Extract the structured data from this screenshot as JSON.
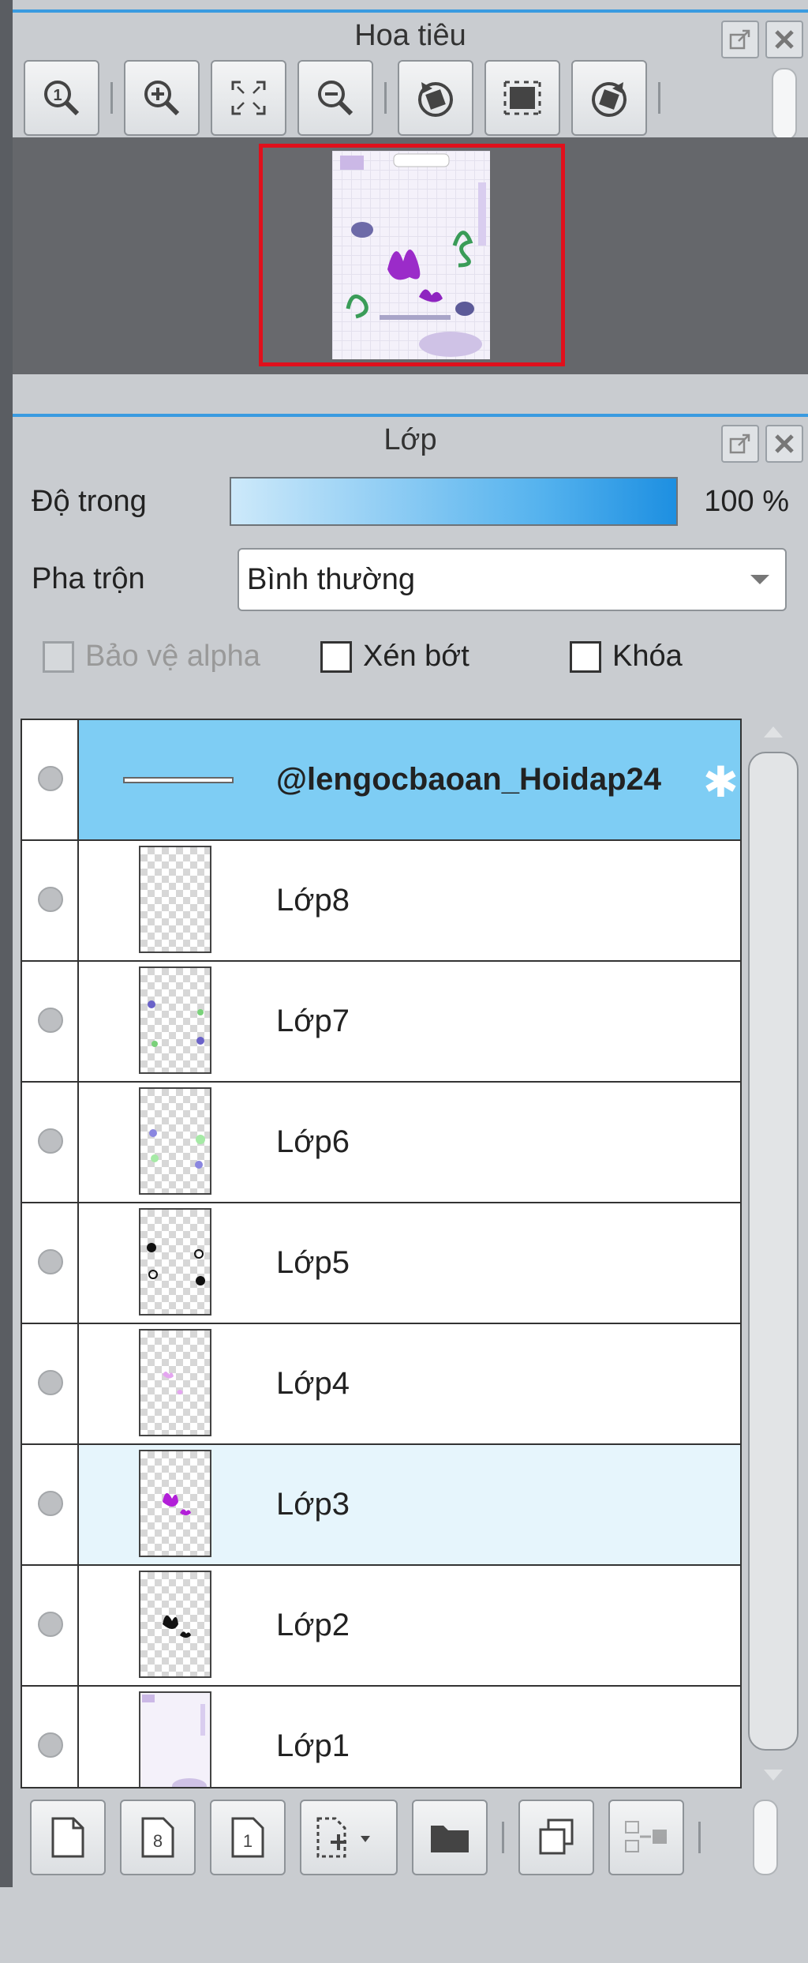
{
  "navigator": {
    "title": "Hoa tiêu"
  },
  "layers_panel": {
    "title": "Lớp",
    "opacity_label": "Độ trong",
    "opacity_value": "100 %",
    "opacity_fraction": 1.0,
    "blend_label": "Pha trộn",
    "blend_value": "Bình thường",
    "protect_alpha_label": "Bảo vệ alpha",
    "clip_label": "Xén bớt",
    "lock_label": "Khóa",
    "layers": [
      {
        "name": "@lengocbaoan_Hoidap24",
        "kind": "folder",
        "state": "active"
      },
      {
        "name": "Lớp8",
        "kind": "layer",
        "state": "normal"
      },
      {
        "name": "Lớp7",
        "kind": "layer",
        "state": "normal"
      },
      {
        "name": "Lớp6",
        "kind": "layer",
        "state": "normal"
      },
      {
        "name": "Lớp5",
        "kind": "layer",
        "state": "normal"
      },
      {
        "name": "Lớp4",
        "kind": "layer",
        "state": "normal"
      },
      {
        "name": "Lớp3",
        "kind": "layer",
        "state": "selected"
      },
      {
        "name": "Lớp2",
        "kind": "layer",
        "state": "normal"
      },
      {
        "name": "Lớp1",
        "kind": "layer",
        "state": "normal"
      }
    ]
  },
  "colors": {
    "accent": "#3a9be0",
    "active_row": "#7ecdf4",
    "selected_row": "#e6f5fc",
    "navigator_frame": "#e0101c"
  }
}
